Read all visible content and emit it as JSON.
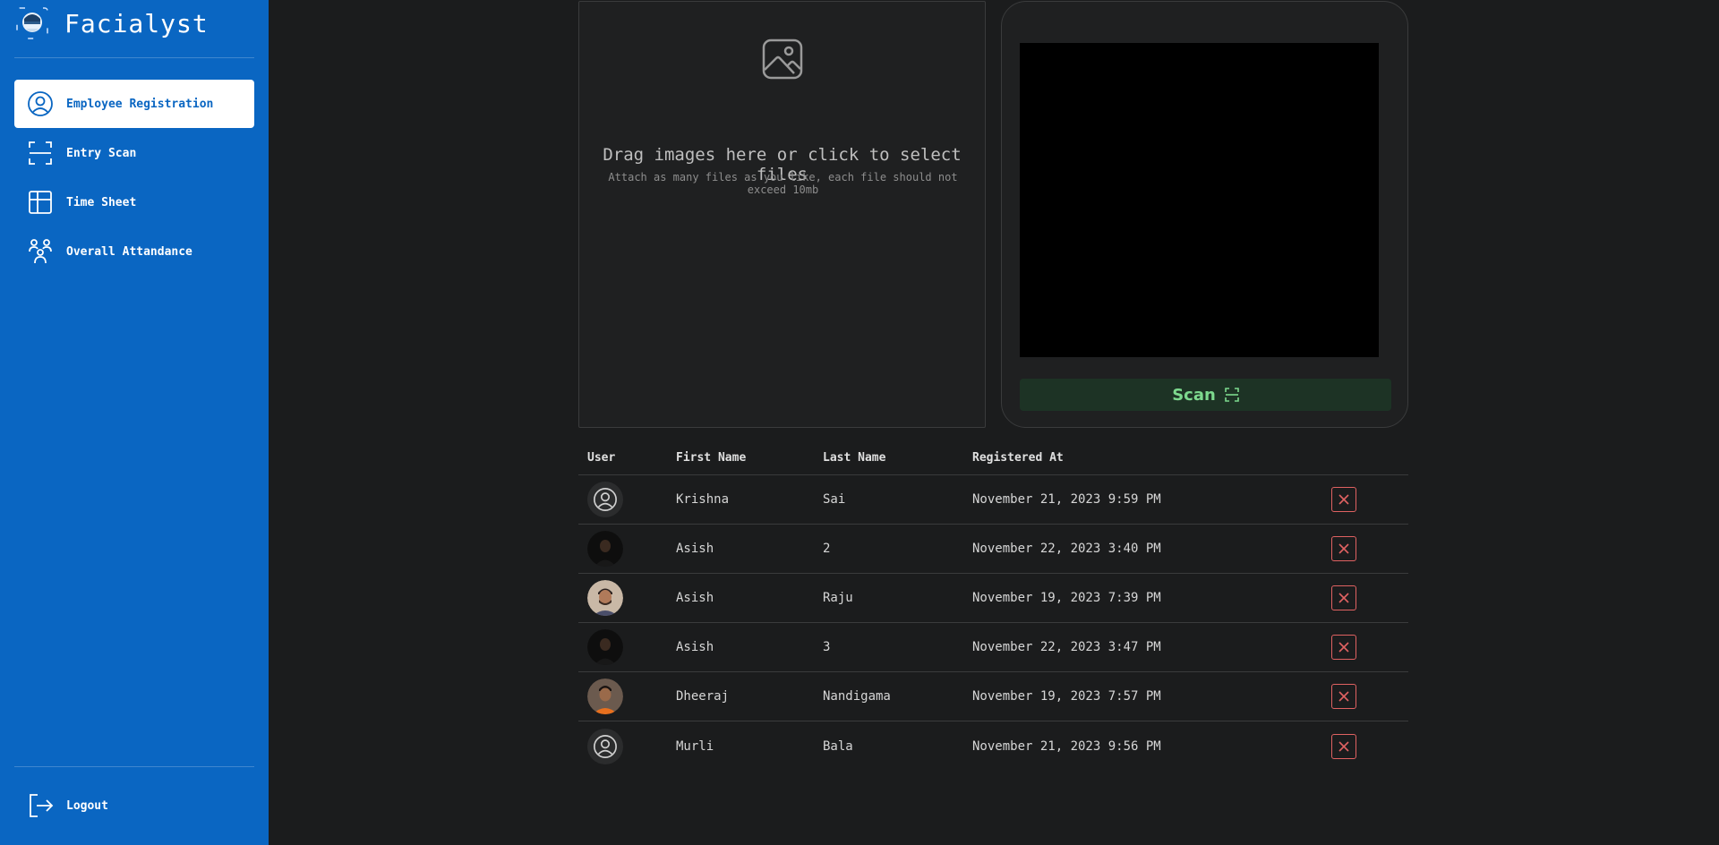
{
  "app": {
    "brand_name": "Facialyst"
  },
  "sidebar": {
    "items": [
      {
        "label": "Employee Registration",
        "icon": "user-circle-icon",
        "active": true
      },
      {
        "label": "Entry Scan",
        "icon": "scan-frame-icon",
        "active": false
      },
      {
        "label": "Time Sheet",
        "icon": "table-grid-icon",
        "active": false
      },
      {
        "label": "Overall Attandance",
        "icon": "users-group-icon",
        "active": false
      }
    ],
    "logout_label": "Logout"
  },
  "upload": {
    "title": "Drag images here or click to select files",
    "hint": "Attach as many files as you like, each file should not exceed 10mb"
  },
  "scanner": {
    "button_label": "Scan"
  },
  "table": {
    "headers": {
      "user": "User",
      "first": "First Name",
      "last": "Last Name",
      "registered": "Registered At"
    },
    "rows": [
      {
        "avatar": "generic",
        "first": "Krishna",
        "last": "Sai",
        "registered": "November 21, 2023 9:59 PM"
      },
      {
        "avatar": "dark-photo",
        "first": "Asish",
        "last": "2",
        "registered": "November 22, 2023 3:40 PM"
      },
      {
        "avatar": "photo-light",
        "first": "Asish",
        "last": "Raju",
        "registered": "November 19, 2023 7:39 PM"
      },
      {
        "avatar": "dark-photo",
        "first": "Asish",
        "last": "3",
        "registered": "November 22, 2023 3:47 PM"
      },
      {
        "avatar": "photo-orange",
        "first": "Dheeraj",
        "last": "Nandigama",
        "registered": "November 19, 2023 7:57 PM"
      },
      {
        "avatar": "generic",
        "first": "Murli",
        "last": "Bala",
        "registered": "November 21, 2023 9:56 PM"
      }
    ]
  },
  "colors": {
    "sidebar": "#0a66c2",
    "background": "#1b1c1d",
    "accent_green": "#7dd98e",
    "delete_red": "#e06262"
  }
}
